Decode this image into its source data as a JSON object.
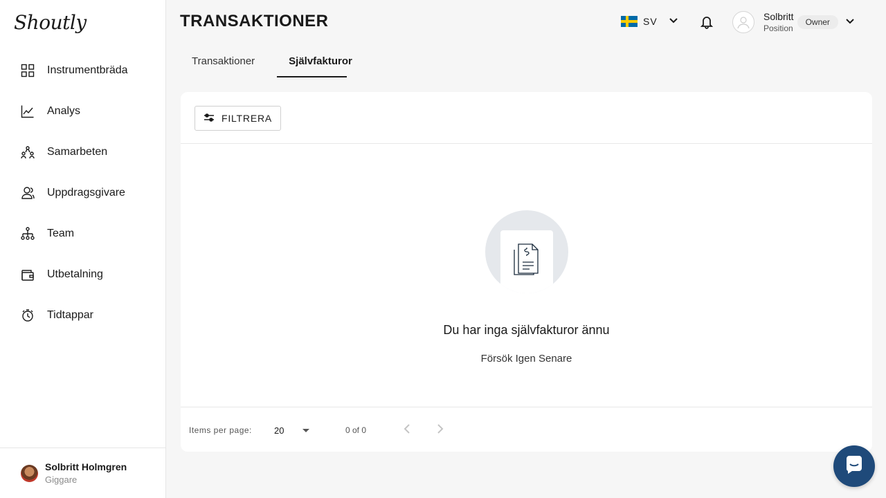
{
  "app": {
    "logo": "Shoutly"
  },
  "sidebar": {
    "items": [
      {
        "label": "Instrumentbräda",
        "icon": "grid-icon"
      },
      {
        "label": "Analys",
        "icon": "chart-line-icon"
      },
      {
        "label": "Samarbeten",
        "icon": "people-network-icon"
      },
      {
        "label": "Uppdragsgivare",
        "icon": "users-icon"
      },
      {
        "label": "Team",
        "icon": "team-tree-icon"
      },
      {
        "label": "Utbetalning",
        "icon": "wallet-icon"
      },
      {
        "label": "Tidtappar",
        "icon": "stopwatch-icon"
      }
    ],
    "user": {
      "name": "Solbritt Holmgren",
      "role": "Giggare"
    }
  },
  "header": {
    "title": "TRANSAKTIONER",
    "language": "SV",
    "profile": {
      "name": "Solbritt",
      "position": "Position",
      "badge": "Owner"
    }
  },
  "tabs": [
    {
      "label": "Transaktioner",
      "active": false
    },
    {
      "label": "Självfakturor",
      "active": true
    }
  ],
  "filter": {
    "label": "FILTRERA"
  },
  "empty_state": {
    "title": "Du har inga självfakturor ännu",
    "subtitle": "Försök Igen Senare"
  },
  "pagination": {
    "items_per_page_label": "Items per page:",
    "items_per_page": "20",
    "range": "0 of 0"
  },
  "colors": {
    "accent": "#1a1a1a",
    "chat": "#1f4a7a",
    "flag_blue": "#006aa7",
    "flag_yellow": "#fecc00"
  }
}
